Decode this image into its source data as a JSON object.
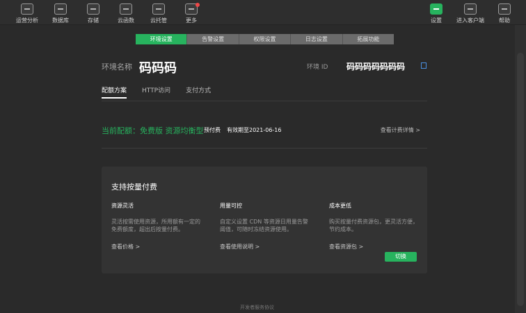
{
  "toolbar": {
    "items": [
      {
        "label": "运营分析",
        "icon": "bar-chart-icon"
      },
      {
        "label": "数据库",
        "icon": "database-icon"
      },
      {
        "label": "存储",
        "icon": "storage-icon"
      },
      {
        "label": "云函数",
        "icon": "cloud-function-icon"
      },
      {
        "label": "云托管",
        "icon": "cloud-hosting-icon"
      },
      {
        "label": "更多",
        "icon": "more-icon"
      }
    ],
    "right_items": [
      {
        "label": "设置",
        "icon": "settings-icon"
      },
      {
        "label": "进入客户端",
        "icon": "client-icon"
      },
      {
        "label": "帮助",
        "icon": "help-icon"
      }
    ],
    "accent_color": "#27b35e",
    "badge_color": "#f04848"
  },
  "tabs": [
    "环境设置",
    "告警设置",
    "权限设置",
    "日志设置",
    "拓展功能"
  ],
  "env": {
    "name_label": "环境名称",
    "name": "码码码",
    "id_label": "环境 ID",
    "id": "码码码码码码码"
  },
  "subtabs": [
    "配额方案",
    "HTTP访问",
    "支付方式"
  ],
  "config": {
    "current": "当前配额：免费版 资源均衡型",
    "pay_type": "预付费",
    "expire": "有效期至2021-06-16",
    "detail_link": "查看计费详情 >"
  },
  "card": {
    "title": "支持按量付费",
    "columns": [
      {
        "title": "资源灵活",
        "desc": "灵活按需使用资源，所用额有一定的免费额度，超出后按量付费。",
        "link": "查看价格 >"
      },
      {
        "title": "用量可控",
        "desc": "自定义设置 CDN 等资源日用量告警阈值，可随时冻结资源使用。",
        "link": "查看使用说明 >"
      },
      {
        "title": "成本更低",
        "desc": "购买按量付费资源包，更灵活方便，节约成本。",
        "link": "查看资源包 >"
      }
    ],
    "switch_label": "切换"
  },
  "footer": "开发者服务协议"
}
